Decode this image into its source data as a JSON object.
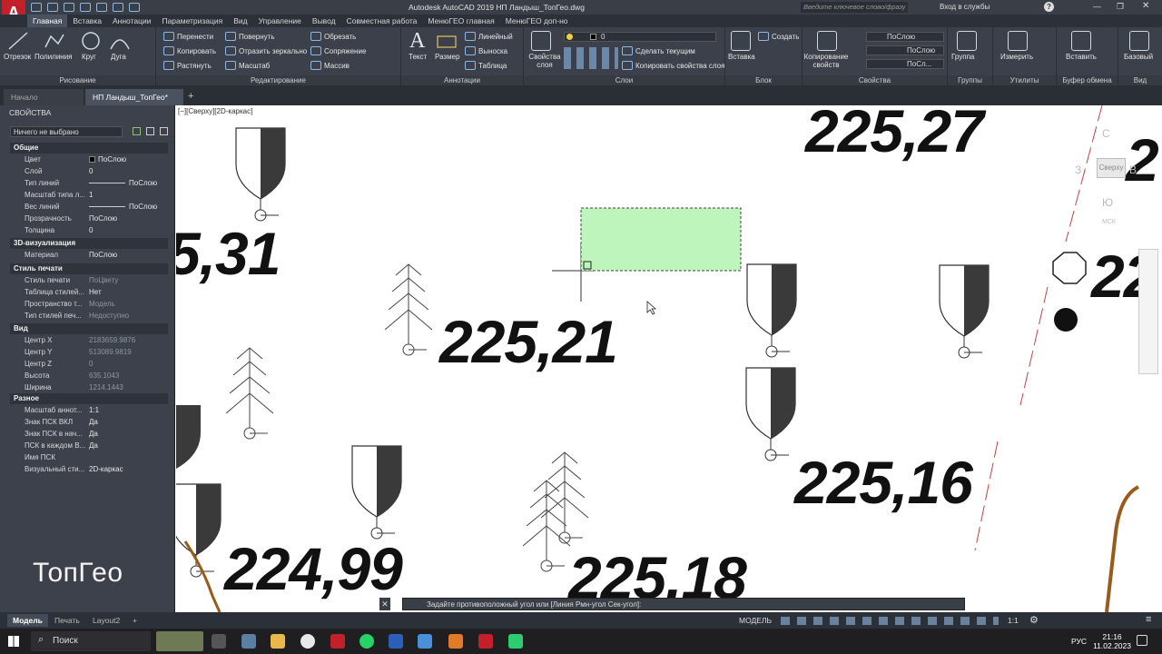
{
  "window": {
    "title": "Autodesk AutoCAD 2019   НП Ландыш_ТопГео.dwg",
    "search_placeholder": "Введите ключевое слово/фразу",
    "login_label": "Вход в службы"
  },
  "menu": [
    "Главная",
    "Вставка",
    "Аннотации",
    "Параметризация",
    "Вид",
    "Управление",
    "Вывод",
    "Совместная работа",
    "МенюГЕО главная",
    "МенюГЕО доп-но"
  ],
  "ribbon": {
    "draw": {
      "title": "Рисование",
      "items": [
        "Отрезок",
        "Полилиния",
        "Круг",
        "Дуга"
      ]
    },
    "edit": {
      "title": "Редактирование",
      "items": [
        "Перенести",
        "Повернуть",
        "Обрезать",
        "Копировать",
        "Отразить зеркально",
        "Сопряжение",
        "Растянуть",
        "Масштаб",
        "Массив"
      ]
    },
    "annot": {
      "title": "Аннотации",
      "items": [
        "Текст",
        "Размер",
        "Линейный",
        "Выноска",
        "Таблица"
      ]
    },
    "layers": {
      "title": "Слои",
      "props_label": "Свойства слоя",
      "layer_value": "0",
      "make_current": "Сделать текущим",
      "copy_props": "Копировать свойства слоя"
    },
    "block": {
      "title": "Блок",
      "insert": "Вставка",
      "create": "Создать"
    },
    "props": {
      "title": "Свойства",
      "copy": "Копирование свойств",
      "color": "ПоСлою",
      "linetype": "ПоСлою",
      "lineweight": "ПоСл..."
    },
    "groups": {
      "title": "Группы",
      "label": "Группа"
    },
    "utils": {
      "title": "Утилиты",
      "label": "Измерить"
    },
    "clip": {
      "title": "Буфер обмена",
      "label": "Вставить"
    },
    "view": {
      "title": "Вид",
      "label": "Базовый"
    }
  },
  "doctabs": [
    "Начало",
    "НП Ландыш_ТопГео*"
  ],
  "props_panel": {
    "title": "СВОЙСТВА",
    "selection": "Ничего не выбрано",
    "cats": {
      "general": "Общие",
      "viz3d": "3D-визуализация",
      "plot": "Стиль печати",
      "view": "Вид",
      "misc": "Разное"
    },
    "general": [
      [
        "Цвет",
        "ПоСлою"
      ],
      [
        "Слой",
        "0"
      ],
      [
        "Тип линий",
        "ПоСлою"
      ],
      [
        "Масштаб типа л...",
        "1"
      ],
      [
        "Вес линий",
        "ПоСлою"
      ],
      [
        "Прозрачность",
        "ПоСлою"
      ],
      [
        "Толщина",
        "0"
      ]
    ],
    "viz3d": [
      [
        "Материал",
        "ПоСлою"
      ]
    ],
    "plot": [
      [
        "Стиль печати",
        "ПоЦвету"
      ],
      [
        "Таблица стилей...",
        "Нет"
      ],
      [
        "Пространство т...",
        "Модель"
      ],
      [
        "Тип стилей печ...",
        "Недоступно"
      ]
    ],
    "view": [
      [
        "Центр X",
        "2183659.9876"
      ],
      [
        "Центр Y",
        "513089.9819"
      ],
      [
        "Центр Z",
        "0"
      ],
      [
        "Высота",
        "635.1043"
      ],
      [
        "Ширина",
        "1214.1443"
      ]
    ],
    "misc": [
      [
        "Масштаб аннот...",
        "1:1"
      ],
      [
        "Знак ПСК ВКЛ",
        "Да"
      ],
      [
        "Знак ПСК в нач...",
        "Да"
      ],
      [
        "ПСК в каждом В...",
        "Да"
      ],
      [
        "Имя ПСК",
        ""
      ],
      [
        "Визуальный сти...",
        "2D-каркас"
      ]
    ]
  },
  "logo": "ТопГео",
  "viewport": {
    "label": "[−][Сверху][2D-каркас]",
    "elevations": [
      "225,27",
      "5,31",
      "225,21",
      "225,16",
      "224,99",
      "225,18",
      "22",
      "2"
    ],
    "viewcube": {
      "top": "Сверху",
      "south": "Ю",
      "east": "В",
      "west": "З",
      "north": "С",
      "ucs": "МСК"
    }
  },
  "command": "Задайте противоположный угол или [Линия Рмн-угол Сек-угол]:",
  "status": {
    "tabs": [
      "Модель",
      "Печать",
      "Layout2"
    ],
    "model_label": "МОДЕЛЬ",
    "scale": "1:1"
  },
  "taskbar": {
    "search": "Поиск",
    "lang": "РУС",
    "time": "21:16",
    "date": "11.02.2023"
  }
}
